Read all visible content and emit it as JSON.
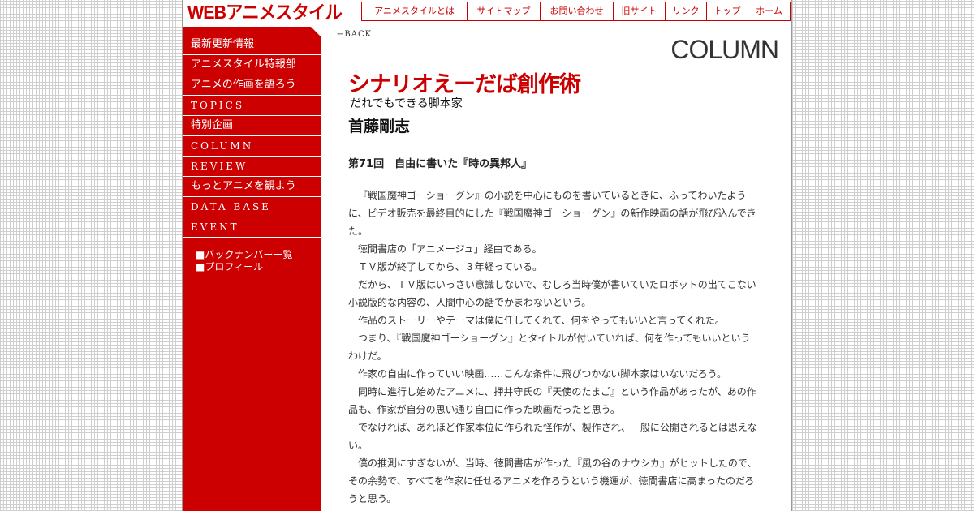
{
  "header": {
    "logo_text": "WEBアニメスタイル",
    "nav": [
      "アニメスタイルとは",
      "サイトマップ",
      "お問い合わせ",
      "旧サイト",
      "リンク",
      "トップ",
      "ホーム"
    ]
  },
  "sidebar": {
    "items": [
      "最新更新情報",
      "アニメスタイル特報部",
      "アニメの作画を語ろう",
      "TOPICS",
      "特別企画",
      "COLUMN",
      "REVIEW",
      "もっとアニメを観よう",
      "DATA BASE",
      "EVENT"
    ],
    "sub_links": [
      "■バックナンバー一覧",
      "■プロフィール"
    ]
  },
  "main": {
    "back_label": "←BACK",
    "section_heading": "COLUMN",
    "series_title": "シナリオえーだば創作術",
    "series_subtitle": "だれでもできる脚本家",
    "author": "首藤剛志",
    "episode_title": "第71回　自由に書いた『時の異邦人』",
    "paragraphs": [
      "『戦国魔神ゴーショーグン』の小説を中心にものを書いているときに、ふってわいたように、ビデオ販売を最終目的にした『戦国魔神ゴーショーグン』の新作映画の話が飛び込んできた。",
      "徳間書店の「アニメージュ」経由である。",
      "ＴＶ版が終了してから、３年経っている。",
      "だから、ＴＶ版はいっさい意識しないで、むしろ当時僕が書いていたロボットの出てこない小説版的な内容の、人間中心の話でかまわないという。",
      "作品のストーリーやテーマは僕に任してくれて、何をやってもいいと言ってくれた。",
      "つまり、『戦国魔神ゴーショーグン』とタイトルが付いていれば、何を作ってもいいというわけだ。",
      "作家の自由に作っていい映画……こんな条件に飛びつかない脚本家はいないだろう。",
      "同時に進行し始めたアニメに、押井守氏の『天使のたまご』という作品があったが、あの作品も、作家が自分の思い通り自由に作った映画だったと思う。",
      "でなければ、あれほど作家本位に作られた怪作が、製作され、一般に公開されるとは思えない。",
      "僕の推測にすぎないが、当時、徳間書店が作った『風の谷のナウシカ』がヒットしたので、その余勢で、すべてを作家に任せるアニメを作ろうという機運が、徳間書店に高まったのだろうと思う。"
    ]
  },
  "colors": {
    "accent": "#cc0000",
    "text": "#333333"
  }
}
